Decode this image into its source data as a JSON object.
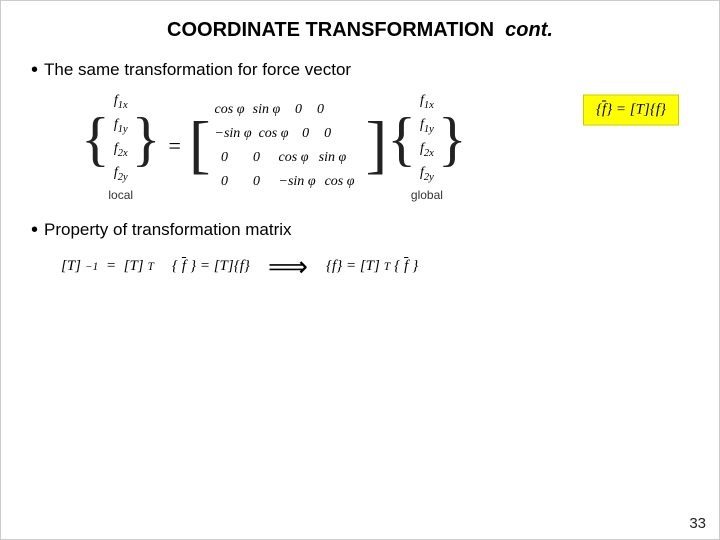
{
  "title": {
    "main": "COORDINATE TRANSFORMATION",
    "italic_part": "cont."
  },
  "section1": {
    "bullet": "•",
    "text": "The same transformation for force vector"
  },
  "section2": {
    "bullet": "•",
    "text": "Property of transformation matrix"
  },
  "matrix": {
    "left_vector": [
      "f₁ₓ",
      "f₁ᵧ",
      "f₂ₓ",
      "f₂ᵧ"
    ],
    "rows": [
      [
        "cos φ",
        "sin φ",
        "0",
        "0"
      ],
      [
        "−sin φ",
        "cos φ",
        "0",
        "0"
      ],
      [
        "0",
        "0",
        "cos φ",
        "sin φ"
      ],
      [
        "0",
        "0",
        "−sin φ",
        "cos φ"
      ]
    ],
    "right_vector": [
      "f₁ₓ",
      "f₁ᵧ",
      "f₂ₓ",
      "f₂ᵧ"
    ]
  },
  "yellow_box": "{f̄} = [T]{f}",
  "labels": {
    "local": "local",
    "global": "global"
  },
  "formulas": {
    "f1": "[T]⁻¹ = [T]ᵀ",
    "f2": "{f̄} = [T]{f}",
    "arrow": "⟹",
    "f3": "{f} = [T]ᵀ{f̄}"
  },
  "page_number": "33"
}
